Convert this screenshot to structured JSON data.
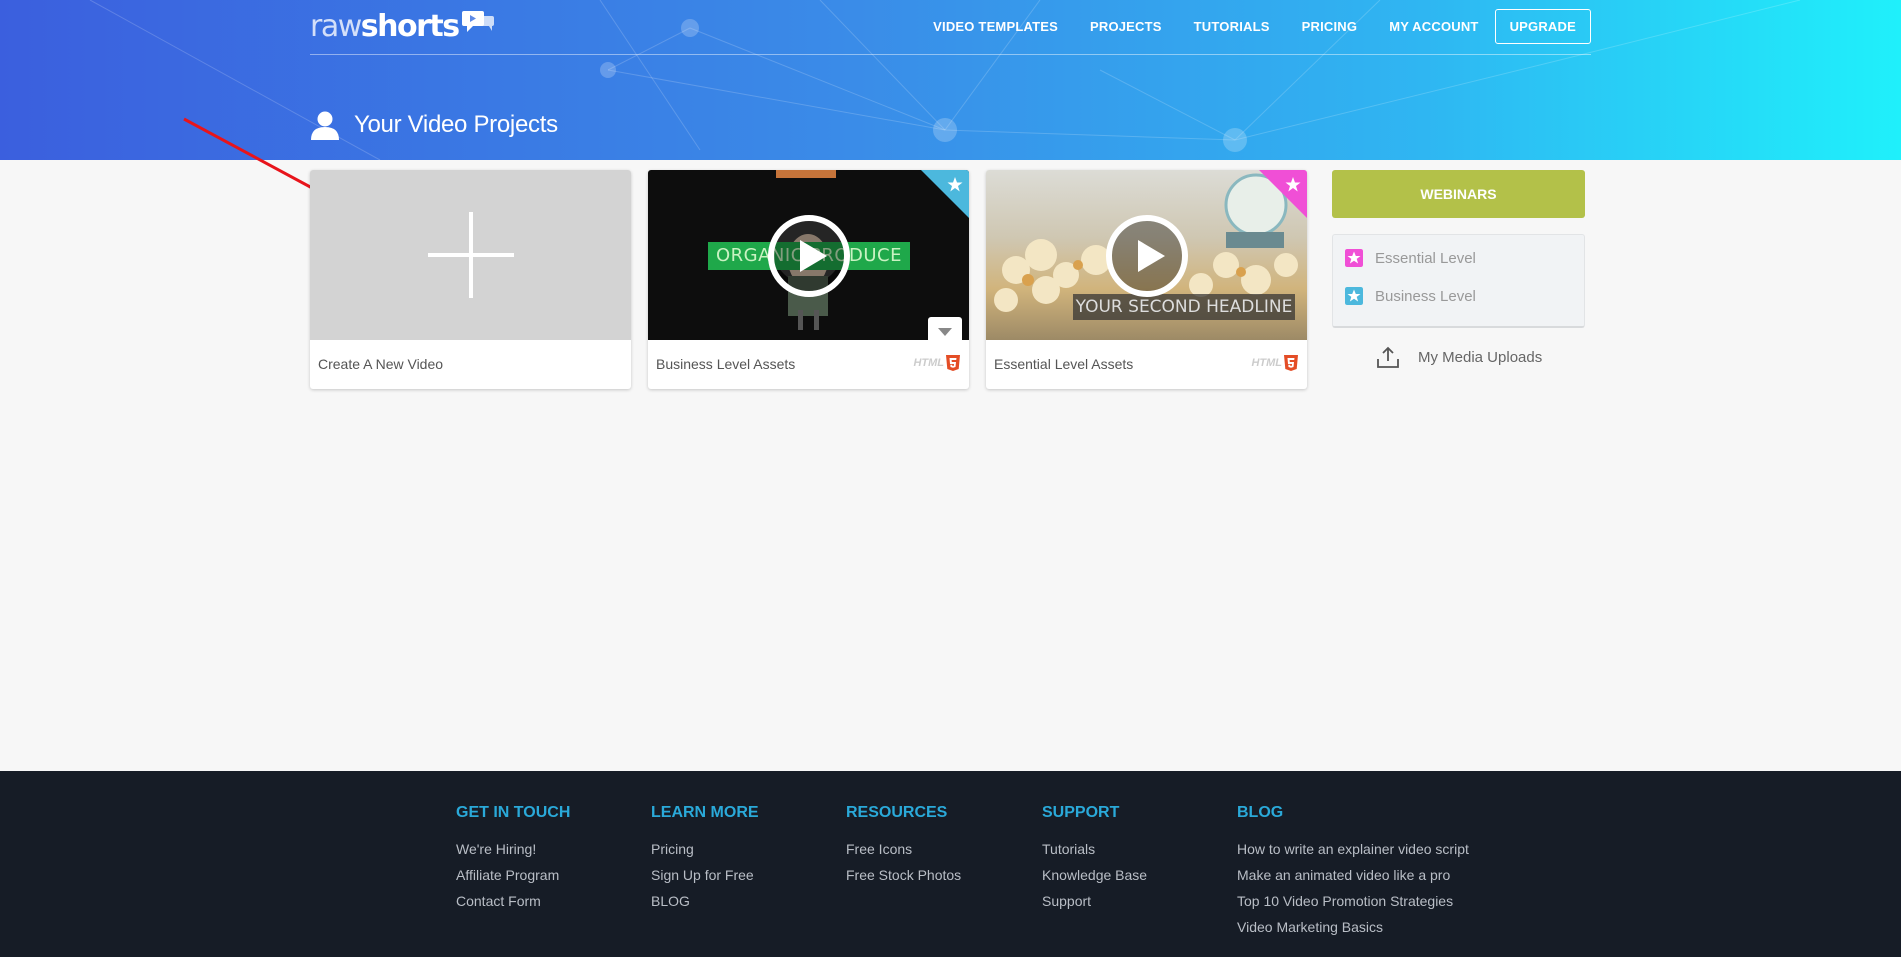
{
  "brand": {
    "logo_part1": "raw",
    "logo_part2": "shorts"
  },
  "nav": {
    "items": [
      "VIDEO TEMPLATES",
      "PROJECTS",
      "TUTORIALS",
      "PRICING",
      "MY ACCOUNT"
    ],
    "upgrade": "UPGRADE"
  },
  "page": {
    "title": "Your Video Projects"
  },
  "cards": [
    {
      "label": "Create A New Video"
    },
    {
      "label": "Business Level Assets",
      "thumb_text": "ORGANIC PRODUCE",
      "tier_color": "#4cb8dd"
    },
    {
      "label": "Essential Level Assets",
      "thumb_text": "YOUR SECOND HEADLINE",
      "tier_color": "#f04fd6"
    }
  ],
  "html5_label": "HTML",
  "sidebar": {
    "webinars": "WEBINARS",
    "levels": [
      {
        "label": "Essential Level",
        "color": "#f04fd6"
      },
      {
        "label": "Business Level",
        "color": "#4cb8dd"
      }
    ],
    "uploads": "My Media Uploads"
  },
  "footer": {
    "columns": [
      {
        "heading": "GET IN TOUCH",
        "links": [
          "We're Hiring!",
          "Affiliate Program",
          "Contact Form"
        ]
      },
      {
        "heading": "LEARN MORE",
        "links": [
          "Pricing",
          "Sign Up for Free",
          "BLOG"
        ]
      },
      {
        "heading": "RESOURCES",
        "links": [
          "Free Icons",
          "Free Stock Photos"
        ]
      },
      {
        "heading": "SUPPORT",
        "links": [
          "Tutorials",
          "Knowledge Base",
          "Support"
        ]
      },
      {
        "heading": "BLOG",
        "links": [
          "How to write an explainer video script",
          "Make an animated video like a pro",
          "Top 10 Video Promotion Strategies",
          "Video Marketing Basics"
        ]
      }
    ]
  },
  "colors": {
    "header_gradient_start": "#3b5fde",
    "header_gradient_end": "#1ff0fb",
    "webinars_button": "#b3c149",
    "footer_bg": "#161c26",
    "footer_heading": "#2aa9d9",
    "annotation_arrow": "#e8141b"
  }
}
